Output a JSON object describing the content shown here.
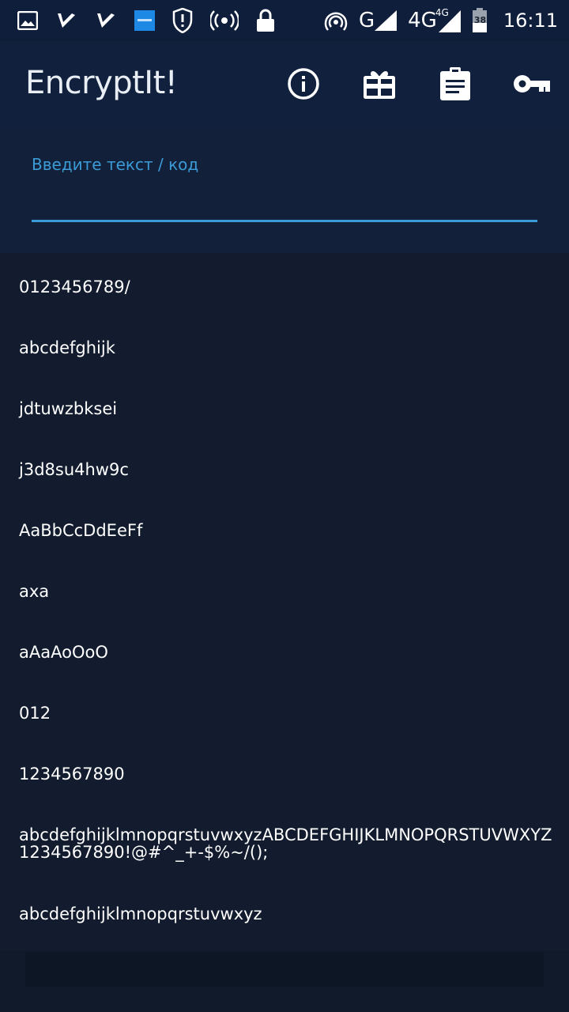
{
  "status_bar": {
    "network_g": "G",
    "network_4g": "4G",
    "network_4g_small": "4G",
    "battery": "38",
    "time": "16:11",
    "icons": [
      "image-icon",
      "check-app-icon",
      "check-app-icon",
      "app-icon",
      "shield-icon",
      "hotspot-icon",
      "lock-icon",
      "wifi-icon",
      "signal-icon",
      "battery-icon"
    ]
  },
  "app_bar": {
    "title": "EncryptIt!",
    "actions": [
      "info-icon",
      "gift-icon",
      "clipboard-icon",
      "key-icon"
    ]
  },
  "input": {
    "label": "Введите текст / код",
    "value": ""
  },
  "list": {
    "items": [
      "0123456789/",
      "abcdefghijk",
      "jdtuwzbksei",
      "j3d8su4hw9c",
      "AaBbCcDdEeFf",
      "axa",
      "aAaAoOoO",
      "012",
      "1234567890",
      "abcdefghijklmnopqrstuvwxyzABCDEFGHIJKLMNOPQRSTUVWXYZ1234567890!@#^_+-$%~/();",
      "abcdefghijklmnopqrstuvwxyz"
    ]
  },
  "colors": {
    "status_bar": "#0f1e3a",
    "app_bar": "#11213d",
    "accent": "#3b9bd6",
    "background": "#121c2e"
  }
}
